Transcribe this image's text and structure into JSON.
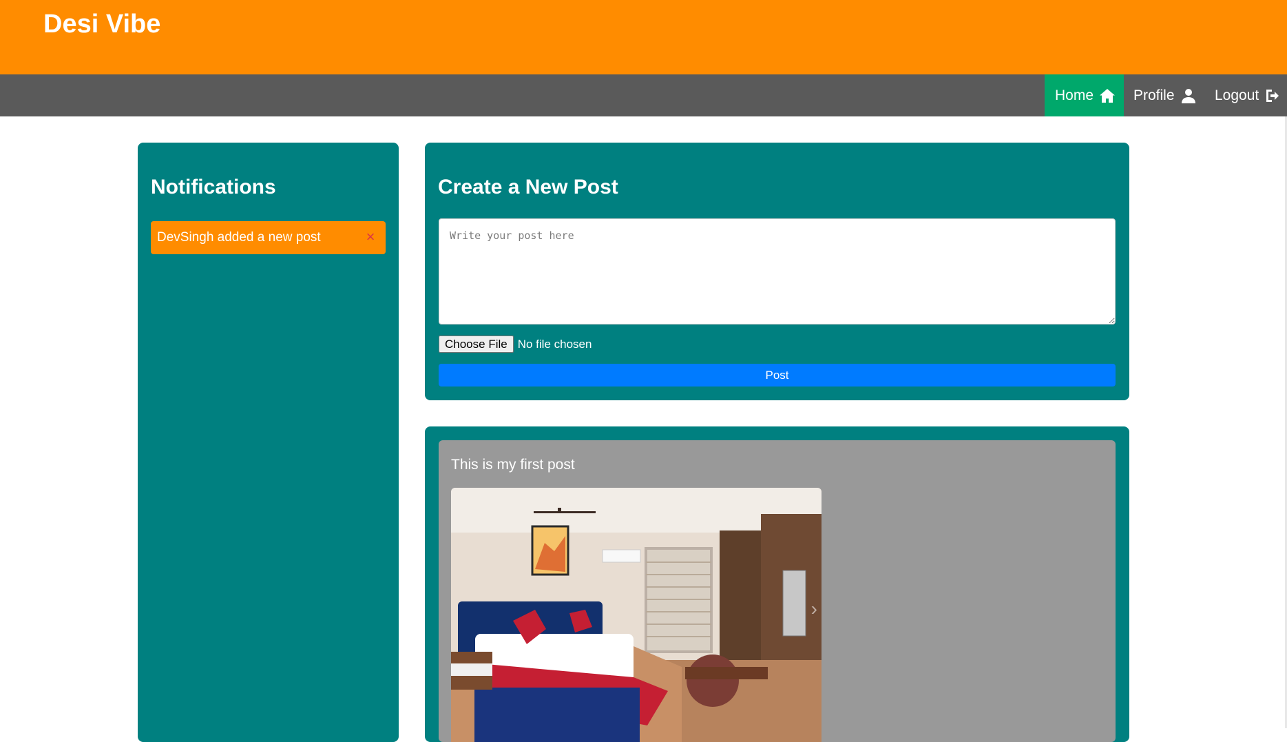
{
  "header": {
    "site_title": "Desi Vibe",
    "background_color": "#ff8c00"
  },
  "nav": {
    "items": [
      {
        "label": "Home",
        "icon": "home-icon",
        "active": true
      },
      {
        "label": "Profile",
        "icon": "user-icon",
        "active": false
      },
      {
        "label": "Logout",
        "icon": "logout-icon",
        "active": false
      }
    ],
    "active_color": "#00a86b",
    "background_color": "#5a5a5a"
  },
  "sidebar": {
    "title": "Notifications",
    "notifications": [
      {
        "text": "DevSingh added a new post"
      }
    ]
  },
  "create_post": {
    "title": "Create a New Post",
    "textarea_placeholder": "Write your post here",
    "choose_file_label": "Choose File",
    "file_status": "No file chosen",
    "post_button_label": "Post"
  },
  "feed": {
    "posts": [
      {
        "text": "This is my first post",
        "image": "bedroom-photo"
      }
    ]
  },
  "colors": {
    "panel": "#008080",
    "post_button": "#007bff",
    "post_background": "#999999"
  }
}
